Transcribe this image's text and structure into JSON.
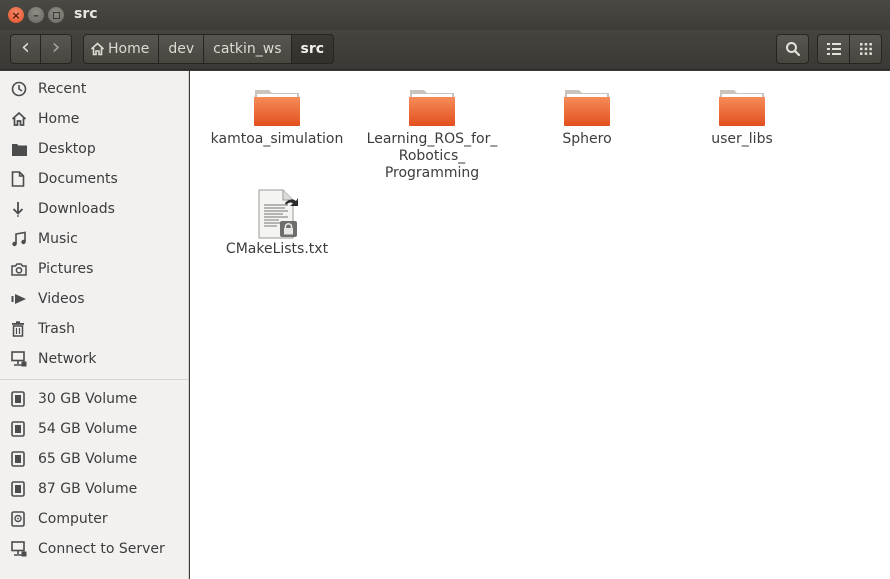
{
  "window": {
    "title": "src"
  },
  "toolbar": {
    "back_glyph": "‹",
    "forward_glyph": "›",
    "breadcrumbs": [
      "Home",
      "dev",
      "catkin_ws",
      "src"
    ],
    "search_icon": "search-icon",
    "list_view_icon": "list-view-icon",
    "grid_view_icon": "grid-view-icon"
  },
  "sidebar": {
    "places": [
      {
        "label": "Recent",
        "icon": "clock-icon"
      },
      {
        "label": "Home",
        "icon": "home-icon"
      },
      {
        "label": "Desktop",
        "icon": "folder-icon"
      },
      {
        "label": "Documents",
        "icon": "document-icon"
      },
      {
        "label": "Downloads",
        "icon": "download-icon"
      },
      {
        "label": "Music",
        "icon": "music-icon"
      },
      {
        "label": "Pictures",
        "icon": "camera-icon"
      },
      {
        "label": "Videos",
        "icon": "video-icon"
      },
      {
        "label": "Trash",
        "icon": "trash-icon"
      },
      {
        "label": "Network",
        "icon": "network-icon"
      }
    ],
    "devices": [
      {
        "label": "30 GB Volume",
        "icon": "drive-icon"
      },
      {
        "label": "54 GB Volume",
        "icon": "drive-icon"
      },
      {
        "label": "65 GB Volume",
        "icon": "drive-icon"
      },
      {
        "label": "87 GB Volume",
        "icon": "drive-icon"
      },
      {
        "label": "Computer",
        "icon": "computer-icon"
      },
      {
        "label": "Connect to Server",
        "icon": "server-icon"
      }
    ]
  },
  "files": [
    {
      "name": "kamtoa_simulation",
      "type": "folder"
    },
    {
      "name": "Learning_ROS_for_ Robotics_ Programming",
      "type": "folder"
    },
    {
      "name": "Sphero",
      "type": "folder"
    },
    {
      "name": "user_libs",
      "type": "folder"
    },
    {
      "name": "CMakeLists.txt",
      "type": "text-file-link"
    }
  ],
  "colors": {
    "folder_orange": "#e95420",
    "folder_light": "#f79a6b",
    "titlebar": "#3c3b37",
    "sidebar_bg": "#f2f1f0"
  }
}
